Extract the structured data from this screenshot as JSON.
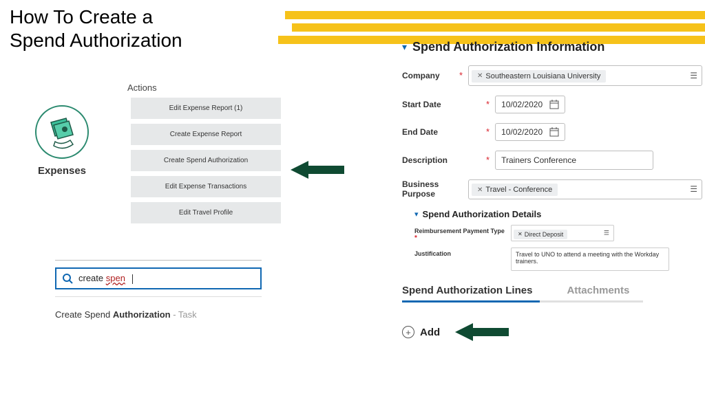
{
  "title_line1": "How To Create a",
  "title_line2": "Spend Authorization",
  "left": {
    "actions_label": "Actions",
    "expenses_label": "Expenses",
    "actions": [
      "Edit Expense Report (1)",
      "Create Expense Report",
      "Create Spend Authorization",
      "Edit Expense Transactions",
      "Edit Travel Profile"
    ],
    "search_prefix": "create ",
    "search_typed": "spen",
    "result_prefix": "Create Spend ",
    "result_bold": "Authorization",
    "result_suffix": " - Task"
  },
  "right": {
    "section_title": "Spend Authorization Information",
    "company_label": "Company",
    "company_value": "Southeastern Louisiana University",
    "start_date_label": "Start Date",
    "start_date_value": "10/02/2020",
    "end_date_label": "End Date",
    "end_date_value": "10/02/2020",
    "description_label": "Description",
    "description_value": "Trainers Conference",
    "purpose_label": "Business Purpose",
    "purpose_value": "Travel - Conference",
    "details_title": "Spend Authorization Details",
    "reimb_label": "Reimbursement Payment Type",
    "reimb_value": "Direct Deposit",
    "just_label": "Justification",
    "just_value": "Travel to UNO to attend a meeting with the Workday trainers.",
    "tab_lines": "Spend Authorization Lines",
    "tab_attach": "Attachments",
    "add_label": "Add"
  }
}
